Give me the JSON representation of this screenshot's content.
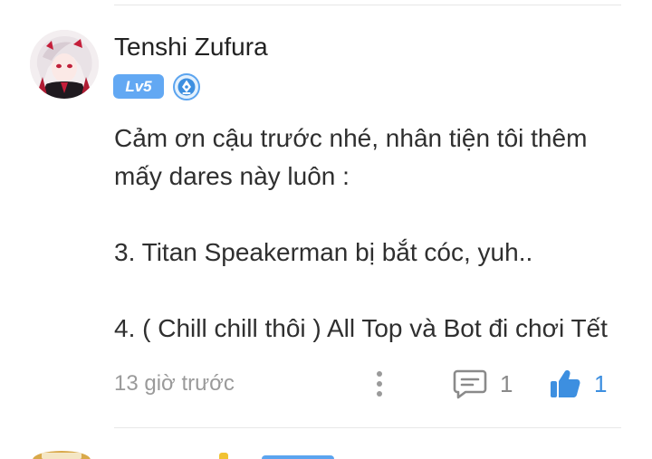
{
  "comment": {
    "author": {
      "name": "Tenshi Zufura",
      "level_label": "Lv5",
      "role_icon": "fountain-pen-badge-icon"
    },
    "body": {
      "line1": "Cảm ơn cậu trước nhé, nhân tiện tôi thêm",
      "line2": "mấy dares này luôn :",
      "line3": "3. Titan Speakerman bị bắt cóc, yuh..",
      "line4": "4. ( Chill chill thôi ) All Top và Bot đi chơi Tết"
    },
    "timestamp": "13 giờ trước",
    "reply_count": "1",
    "like_count": "1"
  },
  "icons": {
    "more": "more-vertical-icon",
    "reply": "comment-icon",
    "like": "thumbs-up-icon"
  },
  "colors": {
    "level_badge": "#62a8f3",
    "like_active": "#3d8fe0",
    "muted_text": "#9a9a9a",
    "divider": "#e7e7e7"
  }
}
